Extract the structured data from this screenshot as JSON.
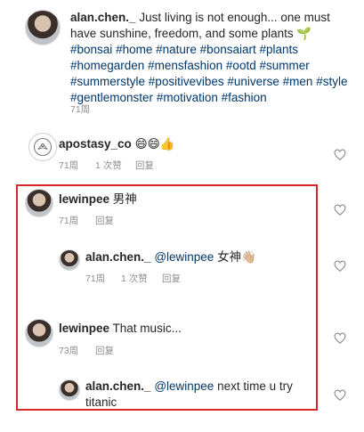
{
  "caption": {
    "username": "alan.chen._",
    "text_parts": [
      {
        "text": "Just living is not enough... one must have sunshine, freedom, and some plants 🌱 ",
        "type": "text"
      },
      {
        "text": "#bonsai",
        "type": "tag"
      },
      {
        "text": " ",
        "type": "text"
      },
      {
        "text": "#home",
        "type": "tag"
      },
      {
        "text": " ",
        "type": "text"
      },
      {
        "text": "#nature",
        "type": "tag"
      },
      {
        "text": " ",
        "type": "text"
      },
      {
        "text": "#bonsaiart",
        "type": "tag"
      },
      {
        "text": " ",
        "type": "text"
      },
      {
        "text": "#plants",
        "type": "tag"
      },
      {
        "text": " ",
        "type": "text"
      },
      {
        "text": "#homegarden",
        "type": "tag"
      },
      {
        "text": " ",
        "type": "text"
      },
      {
        "text": "#mensfashion",
        "type": "tag"
      },
      {
        "text": " ",
        "type": "text"
      },
      {
        "text": "#ootd",
        "type": "tag"
      },
      {
        "text": " ",
        "type": "text"
      },
      {
        "text": "#summer",
        "type": "tag"
      },
      {
        "text": " ",
        "type": "text"
      },
      {
        "text": "#summerstyle",
        "type": "tag"
      },
      {
        "text": " ",
        "type": "text"
      },
      {
        "text": "#positivevibes",
        "type": "tag"
      },
      {
        "text": " ",
        "type": "text"
      },
      {
        "text": "#universe",
        "type": "tag"
      },
      {
        "text": " ",
        "type": "text"
      },
      {
        "text": "#men",
        "type": "tag"
      },
      {
        "text": " ",
        "type": "text"
      },
      {
        "text": "#style",
        "type": "tag"
      },
      {
        "text": " ",
        "type": "text"
      },
      {
        "text": "#gentlemonster",
        "type": "tag"
      },
      {
        "text": " ",
        "type": "text"
      },
      {
        "text": "#motivation",
        "type": "tag"
      },
      {
        "text": " ",
        "type": "text"
      },
      {
        "text": "#fashion",
        "type": "tag"
      }
    ],
    "time": "71周"
  },
  "comments": [
    {
      "username": "apostasy_co",
      "text": "😄😄👍",
      "time": "71周",
      "likes": "1 次赞",
      "reply": "回复"
    },
    {
      "username": "lewinpee",
      "text": "男神",
      "time": "71周",
      "reply": "回复"
    },
    {
      "username": "alan.chen._",
      "mention": "@lewinpee",
      "text": "女神👋🏼",
      "time": "71周",
      "likes": "1 次赞",
      "reply": "回复"
    },
    {
      "username": "lewinpee",
      "text": "That music...",
      "time": "73周",
      "reply": "回复"
    },
    {
      "username": "alan.chen._",
      "mention": "@lewinpee",
      "text": "next time u try titanic",
      "time": "",
      "reply": ""
    }
  ],
  "colors": {
    "text": "#262626",
    "meta": "#8e8e8e",
    "link": "#00376b",
    "highlight_border": "#d4282a"
  },
  "icons": [
    "heart-icon",
    "avatar",
    "apostasy-logo"
  ]
}
